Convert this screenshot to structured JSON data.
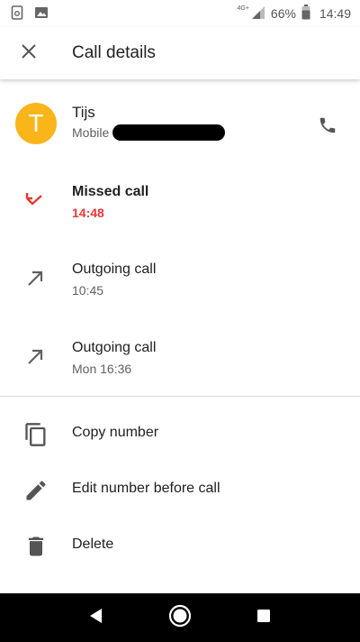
{
  "status_bar": {
    "network": "4G+",
    "battery_percent": "66%",
    "time": "14:49",
    "icons": [
      "sim-icon",
      "image-icon",
      "signal-icon",
      "battery-icon"
    ]
  },
  "app_bar": {
    "title": "Call details",
    "close_icon": "close-icon"
  },
  "contact": {
    "avatar_letter": "T",
    "avatar_color": "#f9b51a",
    "name": "Tijs",
    "number_type": "Mobile",
    "call_icon": "phone-icon"
  },
  "calls": [
    {
      "type": "Missed call",
      "time": "14:48",
      "icon": "missed-call-icon",
      "color": "#e53935"
    },
    {
      "type": "Outgoing call",
      "time": "10:45",
      "icon": "outgoing-call-icon",
      "color": "#616161"
    },
    {
      "type": "Outgoing call",
      "time": "Mon 16:36",
      "icon": "outgoing-call-icon",
      "color": "#616161"
    }
  ],
  "actions": [
    {
      "label": "Copy number",
      "icon": "copy-icon"
    },
    {
      "label": "Edit number before call",
      "icon": "edit-icon"
    },
    {
      "label": "Delete",
      "icon": "delete-icon"
    }
  ],
  "nav_bar": {
    "icons": [
      "back-icon",
      "home-icon",
      "recents-icon"
    ]
  }
}
